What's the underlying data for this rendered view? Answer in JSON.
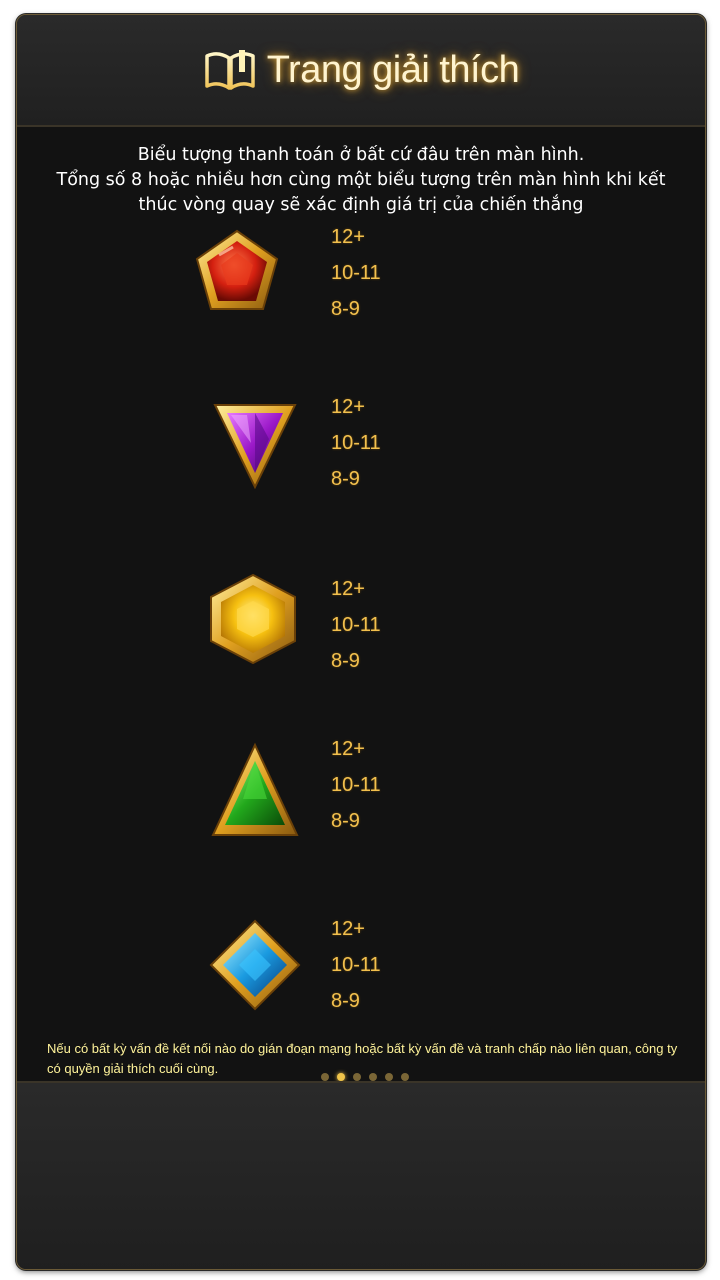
{
  "header": {
    "title": "Trang giải thích",
    "icon": "book-icon"
  },
  "intro": {
    "line1": "Biểu tượng thanh toán ở bất cứ đâu trên màn hình.",
    "line2": "Tổng số 8 hoặc nhiều hơn cùng một biểu tượng trên màn hình khi kết",
    "line3": "thúc vòng quay sẽ xác định giá trị của chiến thắng"
  },
  "symbols": [
    {
      "name": "red-gem-icon",
      "payouts": [
        "12+",
        "10-11",
        "8-9"
      ]
    },
    {
      "name": "purple-gem-icon",
      "payouts": [
        "12+",
        "10-11",
        "8-9"
      ]
    },
    {
      "name": "yellow-gem-icon",
      "payouts": [
        "12+",
        "10-11",
        "8-9"
      ]
    },
    {
      "name": "green-gem-icon",
      "payouts": [
        "12+",
        "10-11",
        "8-9"
      ]
    },
    {
      "name": "blue-gem-icon",
      "payouts": [
        "12+",
        "10-11",
        "8-9"
      ]
    }
  ],
  "footer": {
    "note": "Nếu có bất kỳ vấn đề kết nối nào do gián đoạn mạng hoặc bất kỳ vấn đề và tranh chấp nào liên quan, công ty có quyền giải thích cuối cùng."
  },
  "pagination": {
    "total": 6,
    "current": 2
  },
  "colors": {
    "accent_gold": "#f2c04e",
    "title_glow": "#d8a53a",
    "background": "#121212"
  }
}
